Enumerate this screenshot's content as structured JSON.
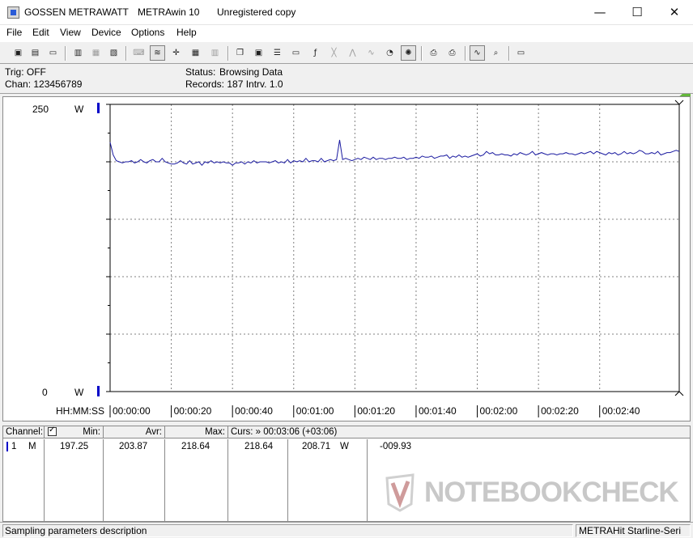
{
  "window": {
    "vendor": "GOSSEN METRAWATT",
    "app": "METRAwin 10",
    "license": "Unregistered copy",
    "minimize_glyph": "—",
    "maximize_glyph": "☐",
    "close_glyph": "✕"
  },
  "menu": [
    "File",
    "Edit",
    "View",
    "Device",
    "Options",
    "Help"
  ],
  "toolbar": {
    "buttons": [
      {
        "icon": "save-icon",
        "glyph": "▣"
      },
      {
        "icon": "save-as-icon",
        "glyph": "▤"
      },
      {
        "icon": "open-folder-icon",
        "glyph": "▭"
      },
      {
        "icon": "device-connect-icon",
        "glyph": "▥"
      },
      {
        "icon": "device-read-icon",
        "glyph": "▦"
      },
      {
        "icon": "device-settings-icon",
        "glyph": "▧"
      },
      {
        "icon": "keyboard-icon",
        "glyph": "⌨"
      },
      {
        "icon": "chart-view-icon",
        "glyph": "≋"
      },
      {
        "icon": "cursor-cross-icon",
        "glyph": "✛"
      },
      {
        "icon": "table-view-icon",
        "glyph": "▦"
      },
      {
        "icon": "histogram-icon",
        "glyph": "▥"
      },
      {
        "icon": "copy-window-icon",
        "glyph": "❐"
      },
      {
        "icon": "print-preview-icon",
        "glyph": "▣"
      },
      {
        "icon": "list-icon",
        "glyph": "☰"
      },
      {
        "icon": "monitor-icon",
        "glyph": "▭"
      },
      {
        "icon": "function-icon",
        "glyph": "ƒ"
      },
      {
        "icon": "xy-plot-icon",
        "glyph": "╳"
      },
      {
        "icon": "trigger-icon",
        "glyph": "⋀"
      },
      {
        "icon": "waveform-icon",
        "glyph": "∿"
      },
      {
        "icon": "zoom-clock-icon",
        "glyph": "◔"
      },
      {
        "icon": "run-icon",
        "glyph": "✺"
      },
      {
        "icon": "printer-icon",
        "glyph": "⎙"
      },
      {
        "icon": "printer-setup-icon",
        "glyph": "⎙"
      },
      {
        "icon": "zoom-signal-icon",
        "glyph": "∿"
      },
      {
        "icon": "zoom-in-icon",
        "glyph": "⌕"
      },
      {
        "icon": "comment-icon",
        "glyph": "▭"
      }
    ]
  },
  "info": {
    "trig": "Trig: OFF",
    "chan": "Chan:  123456789",
    "status_label": "Status:",
    "status_value": "Browsing Data",
    "records": "Records: 187  Intrv. 1.0"
  },
  "chart_data": {
    "type": "line",
    "y_axis_top_label": "250",
    "y_axis_bottom_label": "0",
    "y_unit": "W",
    "x_axis_caption": "HH:MM:SS",
    "ylim": [
      0,
      250
    ],
    "xlim": [
      0,
      186
    ],
    "grid": true,
    "x_ticks": [
      {
        "t": 0,
        "label": "00:00:00"
      },
      {
        "t": 20,
        "label": "00:00:20"
      },
      {
        "t": 40,
        "label": "00:00:40"
      },
      {
        "t": 60,
        "label": "00:01:00"
      },
      {
        "t": 80,
        "label": "00:01:20"
      },
      {
        "t": 100,
        "label": "00:01:40"
      },
      {
        "t": 120,
        "label": "00:02:00"
      },
      {
        "t": 140,
        "label": "00:02:20"
      },
      {
        "t": 160,
        "label": "00:02:40"
      }
    ],
    "y_ticks": [
      0,
      50,
      100,
      150,
      200,
      250
    ],
    "series_color": "#1a1aa0",
    "x": [
      0,
      1,
      2,
      3,
      4,
      5,
      6,
      7,
      8,
      9,
      10,
      11,
      12,
      13,
      14,
      15,
      16,
      17,
      18,
      19,
      20,
      21,
      22,
      23,
      24,
      25,
      26,
      27,
      28,
      29,
      30,
      31,
      32,
      33,
      34,
      35,
      36,
      37,
      38,
      39,
      40,
      41,
      42,
      43,
      44,
      45,
      46,
      47,
      48,
      49,
      50,
      51,
      52,
      53,
      54,
      55,
      56,
      57,
      58,
      59,
      60,
      61,
      62,
      63,
      64,
      65,
      66,
      67,
      68,
      69,
      70,
      71,
      72,
      73,
      74,
      75,
      76,
      77,
      78,
      79,
      80,
      81,
      82,
      83,
      84,
      85,
      86,
      87,
      88,
      89,
      90,
      91,
      92,
      93,
      94,
      95,
      96,
      97,
      98,
      99,
      100,
      101,
      102,
      103,
      104,
      105,
      106,
      107,
      108,
      109,
      110,
      111,
      112,
      113,
      114,
      115,
      116,
      117,
      118,
      119,
      120,
      121,
      122,
      123,
      124,
      125,
      126,
      127,
      128,
      129,
      130,
      131,
      132,
      133,
      134,
      135,
      136,
      137,
      138,
      139,
      140,
      141,
      142,
      143,
      144,
      145,
      146,
      147,
      148,
      149,
      150,
      151,
      152,
      153,
      154,
      155,
      156,
      157,
      158,
      159,
      160,
      161,
      162,
      163,
      164,
      165,
      166,
      167,
      168,
      169,
      170,
      171,
      172,
      173,
      174,
      175,
      176,
      177,
      178,
      179,
      180,
      181,
      182,
      183,
      184,
      185,
      186
    ],
    "y": [
      217,
      206,
      201,
      200,
      199,
      200,
      200,
      201,
      199,
      200,
      202,
      200,
      199,
      201,
      202,
      200,
      200,
      203,
      200,
      199,
      198,
      198,
      199,
      201,
      199,
      198,
      201,
      198,
      199,
      200,
      197,
      200,
      199,
      201,
      199,
      200,
      199,
      200,
      199,
      199,
      197,
      199,
      199,
      200,
      198,
      200,
      199,
      201,
      199,
      200,
      200,
      200,
      199,
      200,
      201,
      199,
      200,
      199,
      202,
      199,
      201,
      200,
      201,
      200,
      203,
      200,
      201,
      201,
      200,
      203,
      200,
      201,
      202,
      201,
      202,
      201,
      202,
      203,
      202,
      201,
      202,
      203,
      202,
      204,
      203,
      202,
      204,
      202,
      203,
      203,
      202,
      203,
      203,
      204,
      203,
      203,
      204,
      202,
      203,
      203,
      204,
      203,
      205,
      204,
      204,
      205,
      203,
      204,
      205,
      205,
      206,
      203,
      205,
      204,
      206,
      204,
      205,
      204,
      205,
      206,
      207,
      205,
      206,
      205,
      207,
      208,
      206,
      206,
      207,
      206,
      206,
      205,
      207,
      206,
      208,
      207,
      206,
      207,
      209,
      206,
      207,
      208,
      207,
      206,
      207,
      207,
      206,
      207,
      207,
      208,
      207,
      207,
      206,
      207,
      208,
      207,
      208,
      209,
      207,
      209,
      208,
      207,
      206,
      208,
      207,
      208,
      206,
      207,
      209,
      207,
      208,
      207,
      208,
      206,
      209,
      207,
      207,
      208,
      207,
      209,
      206,
      207,
      208,
      208,
      209,
      208,
      209
    ],
    "spikes": [
      [
        75,
        219
      ],
      [
        123,
        209
      ],
      [
        173,
        210
      ],
      [
        185,
        210
      ]
    ]
  },
  "stats": {
    "headers": {
      "channel": "Channel:",
      "min": "Min:",
      "avr": "Avr:",
      "max": "Max:",
      "curs": "Curs: » 00:03:06 (+03:06)"
    },
    "row": {
      "num": "1",
      "mode": "M",
      "min": "197.25",
      "avr": "203.87",
      "max": "218.64",
      "curs": "218.64",
      "val": "208.71",
      "unit": "W",
      "delta": "-009.93"
    }
  },
  "watermark": "NOTEBOOKCHECK",
  "statusbar": {
    "left": "Sampling parameters description",
    "right": "METRAHit Starline-Seri"
  }
}
